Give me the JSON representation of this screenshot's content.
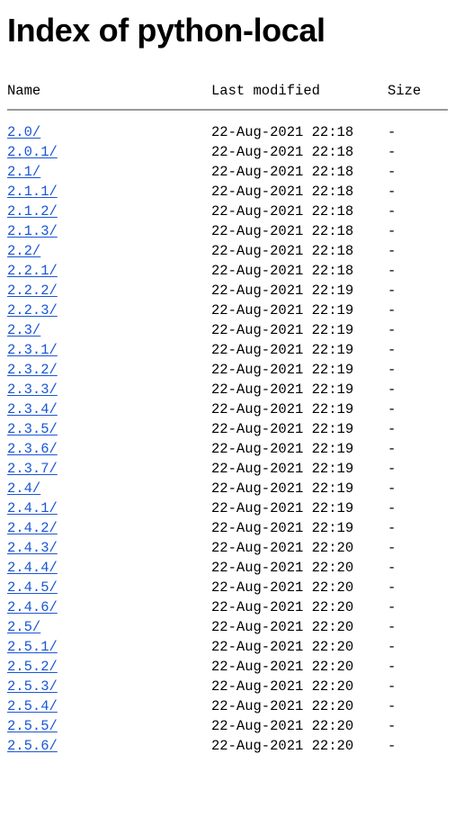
{
  "page": {
    "title": "Index of python-local"
  },
  "table": {
    "columns": {
      "name": "Name",
      "last_modified": "Last modified",
      "size": "Size"
    },
    "rows": [
      {
        "name": "2.0/",
        "date": "22-Aug-2021 22:18",
        "size": "-"
      },
      {
        "name": "2.0.1/",
        "date": "22-Aug-2021 22:18",
        "size": "-"
      },
      {
        "name": "2.1/",
        "date": "22-Aug-2021 22:18",
        "size": "-"
      },
      {
        "name": "2.1.1/",
        "date": "22-Aug-2021 22:18",
        "size": "-"
      },
      {
        "name": "2.1.2/",
        "date": "22-Aug-2021 22:18",
        "size": "-"
      },
      {
        "name": "2.1.3/",
        "date": "22-Aug-2021 22:18",
        "size": "-"
      },
      {
        "name": "2.2/",
        "date": "22-Aug-2021 22:18",
        "size": "-"
      },
      {
        "name": "2.2.1/",
        "date": "22-Aug-2021 22:18",
        "size": "-"
      },
      {
        "name": "2.2.2/",
        "date": "22-Aug-2021 22:19",
        "size": "-"
      },
      {
        "name": "2.2.3/",
        "date": "22-Aug-2021 22:19",
        "size": "-"
      },
      {
        "name": "2.3/",
        "date": "22-Aug-2021 22:19",
        "size": "-"
      },
      {
        "name": "2.3.1/",
        "date": "22-Aug-2021 22:19",
        "size": "-"
      },
      {
        "name": "2.3.2/",
        "date": "22-Aug-2021 22:19",
        "size": "-"
      },
      {
        "name": "2.3.3/",
        "date": "22-Aug-2021 22:19",
        "size": "-"
      },
      {
        "name": "2.3.4/",
        "date": "22-Aug-2021 22:19",
        "size": "-"
      },
      {
        "name": "2.3.5/",
        "date": "22-Aug-2021 22:19",
        "size": "-"
      },
      {
        "name": "2.3.6/",
        "date": "22-Aug-2021 22:19",
        "size": "-"
      },
      {
        "name": "2.3.7/",
        "date": "22-Aug-2021 22:19",
        "size": "-"
      },
      {
        "name": "2.4/",
        "date": "22-Aug-2021 22:19",
        "size": "-"
      },
      {
        "name": "2.4.1/",
        "date": "22-Aug-2021 22:19",
        "size": "-"
      },
      {
        "name": "2.4.2/",
        "date": "22-Aug-2021 22:19",
        "size": "-"
      },
      {
        "name": "2.4.3/",
        "date": "22-Aug-2021 22:20",
        "size": "-"
      },
      {
        "name": "2.4.4/",
        "date": "22-Aug-2021 22:20",
        "size": "-"
      },
      {
        "name": "2.4.5/",
        "date": "22-Aug-2021 22:20",
        "size": "-"
      },
      {
        "name": "2.4.6/",
        "date": "22-Aug-2021 22:20",
        "size": "-"
      },
      {
        "name": "2.5/",
        "date": "22-Aug-2021 22:20",
        "size": "-"
      },
      {
        "name": "2.5.1/",
        "date": "22-Aug-2021 22:20",
        "size": "-"
      },
      {
        "name": "2.5.2/",
        "date": "22-Aug-2021 22:20",
        "size": "-"
      },
      {
        "name": "2.5.3/",
        "date": "22-Aug-2021 22:20",
        "size": "-"
      },
      {
        "name": "2.5.4/",
        "date": "22-Aug-2021 22:20",
        "size": "-"
      },
      {
        "name": "2.5.5/",
        "date": "22-Aug-2021 22:20",
        "size": "-"
      },
      {
        "name": "2.5.6/",
        "date": "22-Aug-2021 22:20",
        "size": "-"
      }
    ]
  },
  "colors": {
    "link": "#1a56d6",
    "text": "#000000",
    "background": "#ffffff",
    "rule": "#999999"
  }
}
